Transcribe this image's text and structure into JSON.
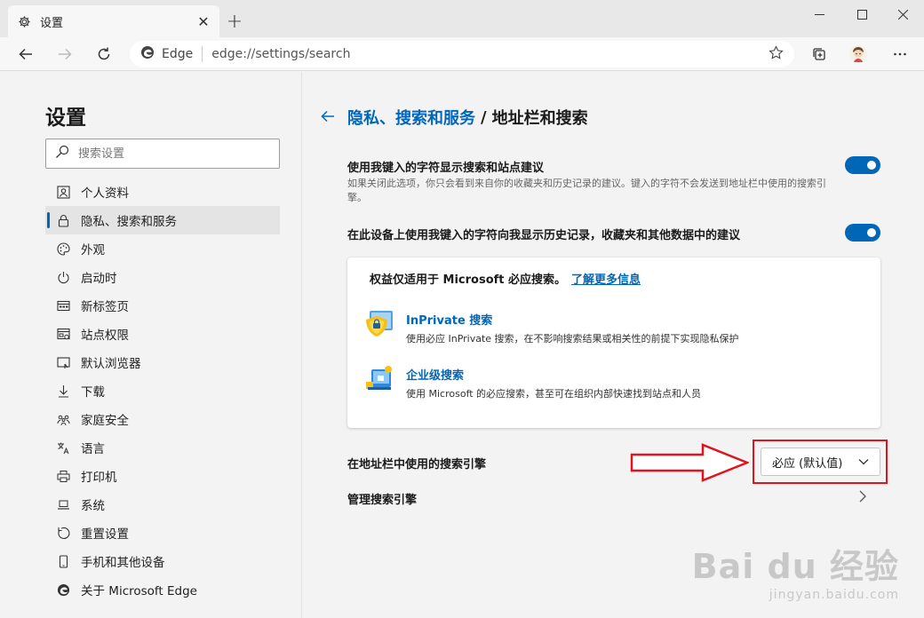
{
  "browser": {
    "tab_title": "设置",
    "address_site": "Edge",
    "address_url": "edge://settings/search"
  },
  "sidebar": {
    "title": "设置",
    "search_placeholder": "搜索设置",
    "items": [
      {
        "label": "个人资料",
        "icon": "profile-icon"
      },
      {
        "label": "隐私、搜索和服务",
        "icon": "lock-icon",
        "active": true
      },
      {
        "label": "外观",
        "icon": "palette-icon"
      },
      {
        "label": "启动时",
        "icon": "power-icon"
      },
      {
        "label": "新标签页",
        "icon": "newtab-icon"
      },
      {
        "label": "站点权限",
        "icon": "site-permissions-icon"
      },
      {
        "label": "默认浏览器",
        "icon": "default-browser-icon"
      },
      {
        "label": "下载",
        "icon": "download-icon"
      },
      {
        "label": "家庭安全",
        "icon": "family-icon"
      },
      {
        "label": "语言",
        "icon": "language-icon"
      },
      {
        "label": "打印机",
        "icon": "printer-icon"
      },
      {
        "label": "系统",
        "icon": "system-icon"
      },
      {
        "label": "重置设置",
        "icon": "reset-icon"
      },
      {
        "label": "手机和其他设备",
        "icon": "phone-icon"
      },
      {
        "label": "关于 Microsoft Edge",
        "icon": "edge-logo-icon"
      }
    ]
  },
  "main": {
    "breadcrumb_parent": "隐私、搜索和服务",
    "breadcrumb_sep": "/",
    "breadcrumb_current": "地址栏和搜索",
    "setting1_title": "使用我键入的字符显示搜索和站点建议",
    "setting1_desc": "如果关闭此选项，你只会看到来自你的收藏夹和历史记录的建议。键入的字符不会发送到地址栏中使用的搜索引擎。",
    "setting1_on": true,
    "setting2_title": "在此设备上使用我键入的字符向我显示历史记录，收藏夹和其他数据中的建议",
    "setting2_on": true,
    "card_head": "权益仅适用于 Microsoft 必应搜索。",
    "card_link": "了解更多信息",
    "feature1_title": "InPrivate 搜索",
    "feature1_desc": "使用必应 InPrivate 搜索，在不影响搜索结果或相关性的前提下实现隐私保护",
    "feature2_title": "企业级搜索",
    "feature2_desc": "使用 Microsoft 的必应搜索，甚至可在组织内部快速找到站点和人员",
    "engine_label": "在地址栏中使用的搜索引擎",
    "engine_value": "必应 (默认值)",
    "manage_label": "管理搜索引擎"
  },
  "watermark": {
    "line1": "Bai du 经验",
    "line2": "jingyan.baidu.com"
  },
  "colors": {
    "accent": "#0067b8",
    "highlight": "#e0141e"
  }
}
